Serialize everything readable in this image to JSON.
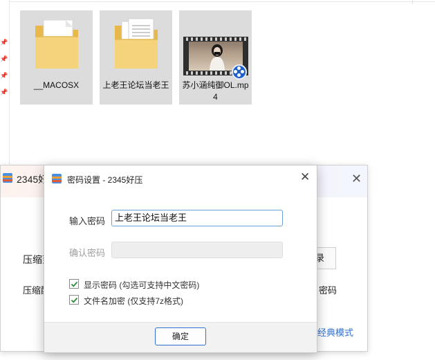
{
  "explorer": {
    "files": [
      {
        "name": "__MACOSX",
        "type": "folder-empty"
      },
      {
        "name": "上老王论坛当老王",
        "type": "folder-docs"
      },
      {
        "name": "苏小涵纯御OL.mp4",
        "type": "video"
      }
    ]
  },
  "main_window": {
    "title": "2345好",
    "label_compress_to": "压缩到",
    "label_compress_config": "压缩配",
    "browse_partial": "录",
    "right_partial": "密码",
    "link_classic": "经典模式"
  },
  "dialog": {
    "title": "密码设置 - 2345好压",
    "password_label": "输入密码",
    "password_value": "上老王论坛当老王",
    "confirm_label": "确认密码",
    "confirm_value": "",
    "show_password_label": "显示密码 (勾选可支持中文密码)",
    "show_password_checked": true,
    "encrypt_filenames_label": "文件名加密 (仅支持7z格式)",
    "encrypt_filenames_checked": true,
    "ok_label": "确定"
  },
  "colors": {
    "accent": "#2f6fd1",
    "folder": "#f5d37a",
    "input_focus": "#6aa0d8",
    "check": "#2a8a3a"
  }
}
